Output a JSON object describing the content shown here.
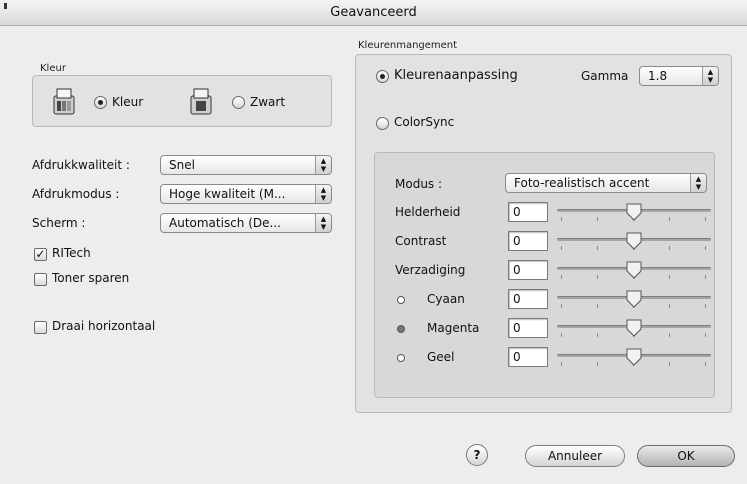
{
  "window": {
    "title": "Geavanceerd"
  },
  "kleur_group": {
    "title": "Kleur",
    "options": [
      {
        "label": "Kleur",
        "selected": true,
        "icon": "color-printer-icon"
      },
      {
        "label": "Zwart",
        "selected": false,
        "icon": "mono-printer-icon"
      }
    ]
  },
  "left_settings": [
    {
      "label": "Afdrukkwaliteit :",
      "value": "Snel"
    },
    {
      "label": "Afdrukmodus :",
      "value": "Hoge kwaliteit (M..."
    },
    {
      "label": "Scherm :",
      "value": "Automatisch (De..."
    }
  ],
  "checkboxes": [
    {
      "label": "RITech",
      "checked": true
    },
    {
      "label": "Toner sparen",
      "checked": false
    },
    {
      "label": "Draai horizontaal",
      "checked": false
    }
  ],
  "color_management": {
    "title": "Kleurenmangement",
    "option_adjust": {
      "label": "Kleurenaanpassing",
      "selected": true
    },
    "option_colorsync": {
      "label": "ColorSync",
      "selected": false
    },
    "gamma": {
      "label": "Gamma",
      "value": "1.8"
    },
    "mode": {
      "label": "Modus :",
      "value": "Foto-realistisch accent"
    },
    "sliders": [
      {
        "label": "Helderheid",
        "value": "0",
        "dot": "none"
      },
      {
        "label": "Contrast",
        "value": "0",
        "dot": "none"
      },
      {
        "label": "Verzadiging",
        "value": "0",
        "dot": "none"
      },
      {
        "label": "Cyaan",
        "value": "0",
        "dot": "empty"
      },
      {
        "label": "Magenta",
        "value": "0",
        "dot": "filled"
      },
      {
        "label": "Geel",
        "value": "0",
        "dot": "empty"
      }
    ]
  },
  "footer": {
    "help": "?",
    "cancel": "Annuleer",
    "ok": "OK"
  }
}
